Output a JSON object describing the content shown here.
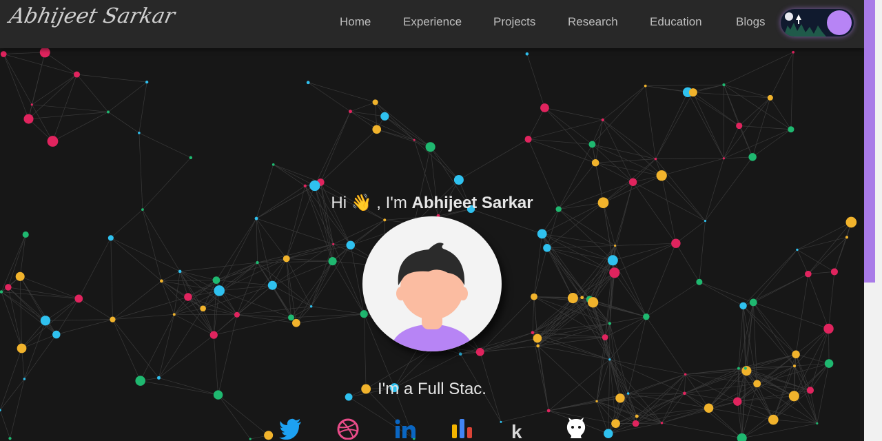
{
  "header": {
    "logo_text": "Abhijeet Sarkar",
    "nav": [
      "Home",
      "Experience",
      "Projects",
      "Research",
      "Education",
      "Blogs"
    ],
    "theme_toggle": {
      "state": "dark"
    }
  },
  "hero": {
    "greeting_prefix": "Hi",
    "wave_emoji": "👋",
    "greeting_mid": ", I'm",
    "name": "Abhijeet Sarkar",
    "tagline": "I'm a Full Stac."
  },
  "social": [
    {
      "name": "twitter-icon",
      "color": "#1da1f2"
    },
    {
      "name": "dribbble-icon",
      "color": "#ea4c89"
    },
    {
      "name": "linkedin-icon",
      "color": "#0a66c2"
    },
    {
      "name": "analytics-icon",
      "color": "#f4b400"
    },
    {
      "name": "kaggle-icon",
      "color": "#d8d8d8"
    },
    {
      "name": "github-icon",
      "color": "#ffffff"
    }
  ],
  "colors": {
    "background": "#171717",
    "navbar": "#282828",
    "accent": "#b784f5",
    "particles": [
      "#e0245e",
      "#1fb870",
      "#2fc1ef",
      "#f1b32c"
    ]
  }
}
